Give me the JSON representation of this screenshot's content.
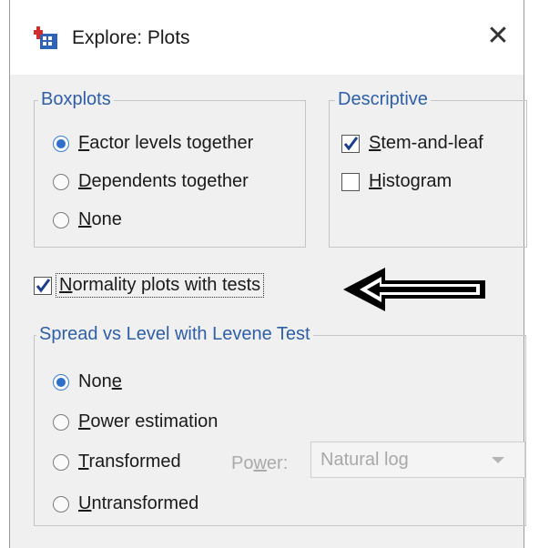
{
  "window": {
    "title": "Explore: Plots"
  },
  "boxplots": {
    "legend": "Boxplots",
    "options": [
      {
        "pre": "",
        "ul": "F",
        "post": "actor levels together",
        "selected": true
      },
      {
        "pre": "",
        "ul": "D",
        "post": "ependents together",
        "selected": false
      },
      {
        "pre": "",
        "ul": "N",
        "post": "one",
        "selected": false
      }
    ]
  },
  "descriptive": {
    "legend": "Descriptive",
    "options": [
      {
        "pre": "",
        "ul": "S",
        "post": "tem-and-leaf",
        "checked": true
      },
      {
        "pre": "",
        "ul": "H",
        "post": "istogram",
        "checked": false
      }
    ]
  },
  "normality": {
    "pre": "",
    "ul": "N",
    "post": "ormality plots with tests",
    "checked": true
  },
  "spread": {
    "legend": "Spread vs Level with Levene Test",
    "options": [
      {
        "pre": "Non",
        "ul": "e",
        "post": "",
        "selected": true
      },
      {
        "pre": "",
        "ul": "P",
        "post": "ower estimation",
        "selected": false
      },
      {
        "pre": "",
        "ul": "T",
        "post": "ransformed",
        "selected": false
      },
      {
        "pre": "",
        "ul": "U",
        "post": "ntransformed",
        "selected": false
      }
    ],
    "power_pre": "Po",
    "power_ul": "w",
    "power_post": "er:",
    "power_value": "Natural log"
  },
  "colors": {
    "legend": "#2e5fa6",
    "radio_selected": "#2f6fc9",
    "background": "#f0f0f0"
  }
}
